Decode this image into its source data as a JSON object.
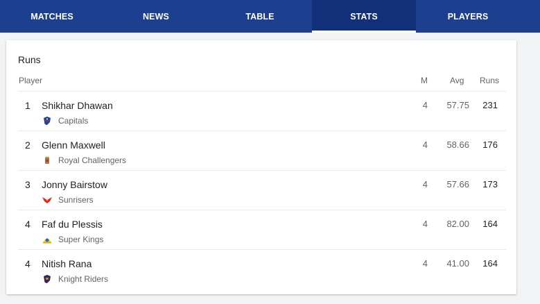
{
  "tabs": [
    {
      "label": "MATCHES",
      "active": false
    },
    {
      "label": "NEWS",
      "active": false
    },
    {
      "label": "TABLE",
      "active": false
    },
    {
      "label": "STATS",
      "active": true
    },
    {
      "label": "PLAYERS",
      "active": false
    }
  ],
  "colors": {
    "tab_bar": "#1c3f8f",
    "tab_active": "#123079",
    "text_primary": "#202124",
    "text_secondary": "#5f6368"
  },
  "stats": {
    "title": "Runs",
    "headers": {
      "player": "Player",
      "matches": "M",
      "average": "Avg",
      "runs": "Runs"
    },
    "rows": [
      {
        "rank": "1",
        "player": "Shikhar Dhawan",
        "team": "Capitals",
        "team_icon": "capitals-logo-icon",
        "matches": "4",
        "average": "57.75",
        "runs": "231"
      },
      {
        "rank": "2",
        "player": "Glenn Maxwell",
        "team": "Royal Challengers",
        "team_icon": "royal-challengers-logo-icon",
        "matches": "4",
        "average": "58.66",
        "runs": "176"
      },
      {
        "rank": "3",
        "player": "Jonny Bairstow",
        "team": "Sunrisers",
        "team_icon": "sunrisers-logo-icon",
        "matches": "4",
        "average": "57.66",
        "runs": "173"
      },
      {
        "rank": "4",
        "player": "Faf du Plessis",
        "team": "Super Kings",
        "team_icon": "super-kings-logo-icon",
        "matches": "4",
        "average": "82.00",
        "runs": "164"
      },
      {
        "rank": "4",
        "player": "Nitish Rana",
        "team": "Knight Riders",
        "team_icon": "knight-riders-logo-icon",
        "matches": "4",
        "average": "41.00",
        "runs": "164"
      }
    ]
  }
}
